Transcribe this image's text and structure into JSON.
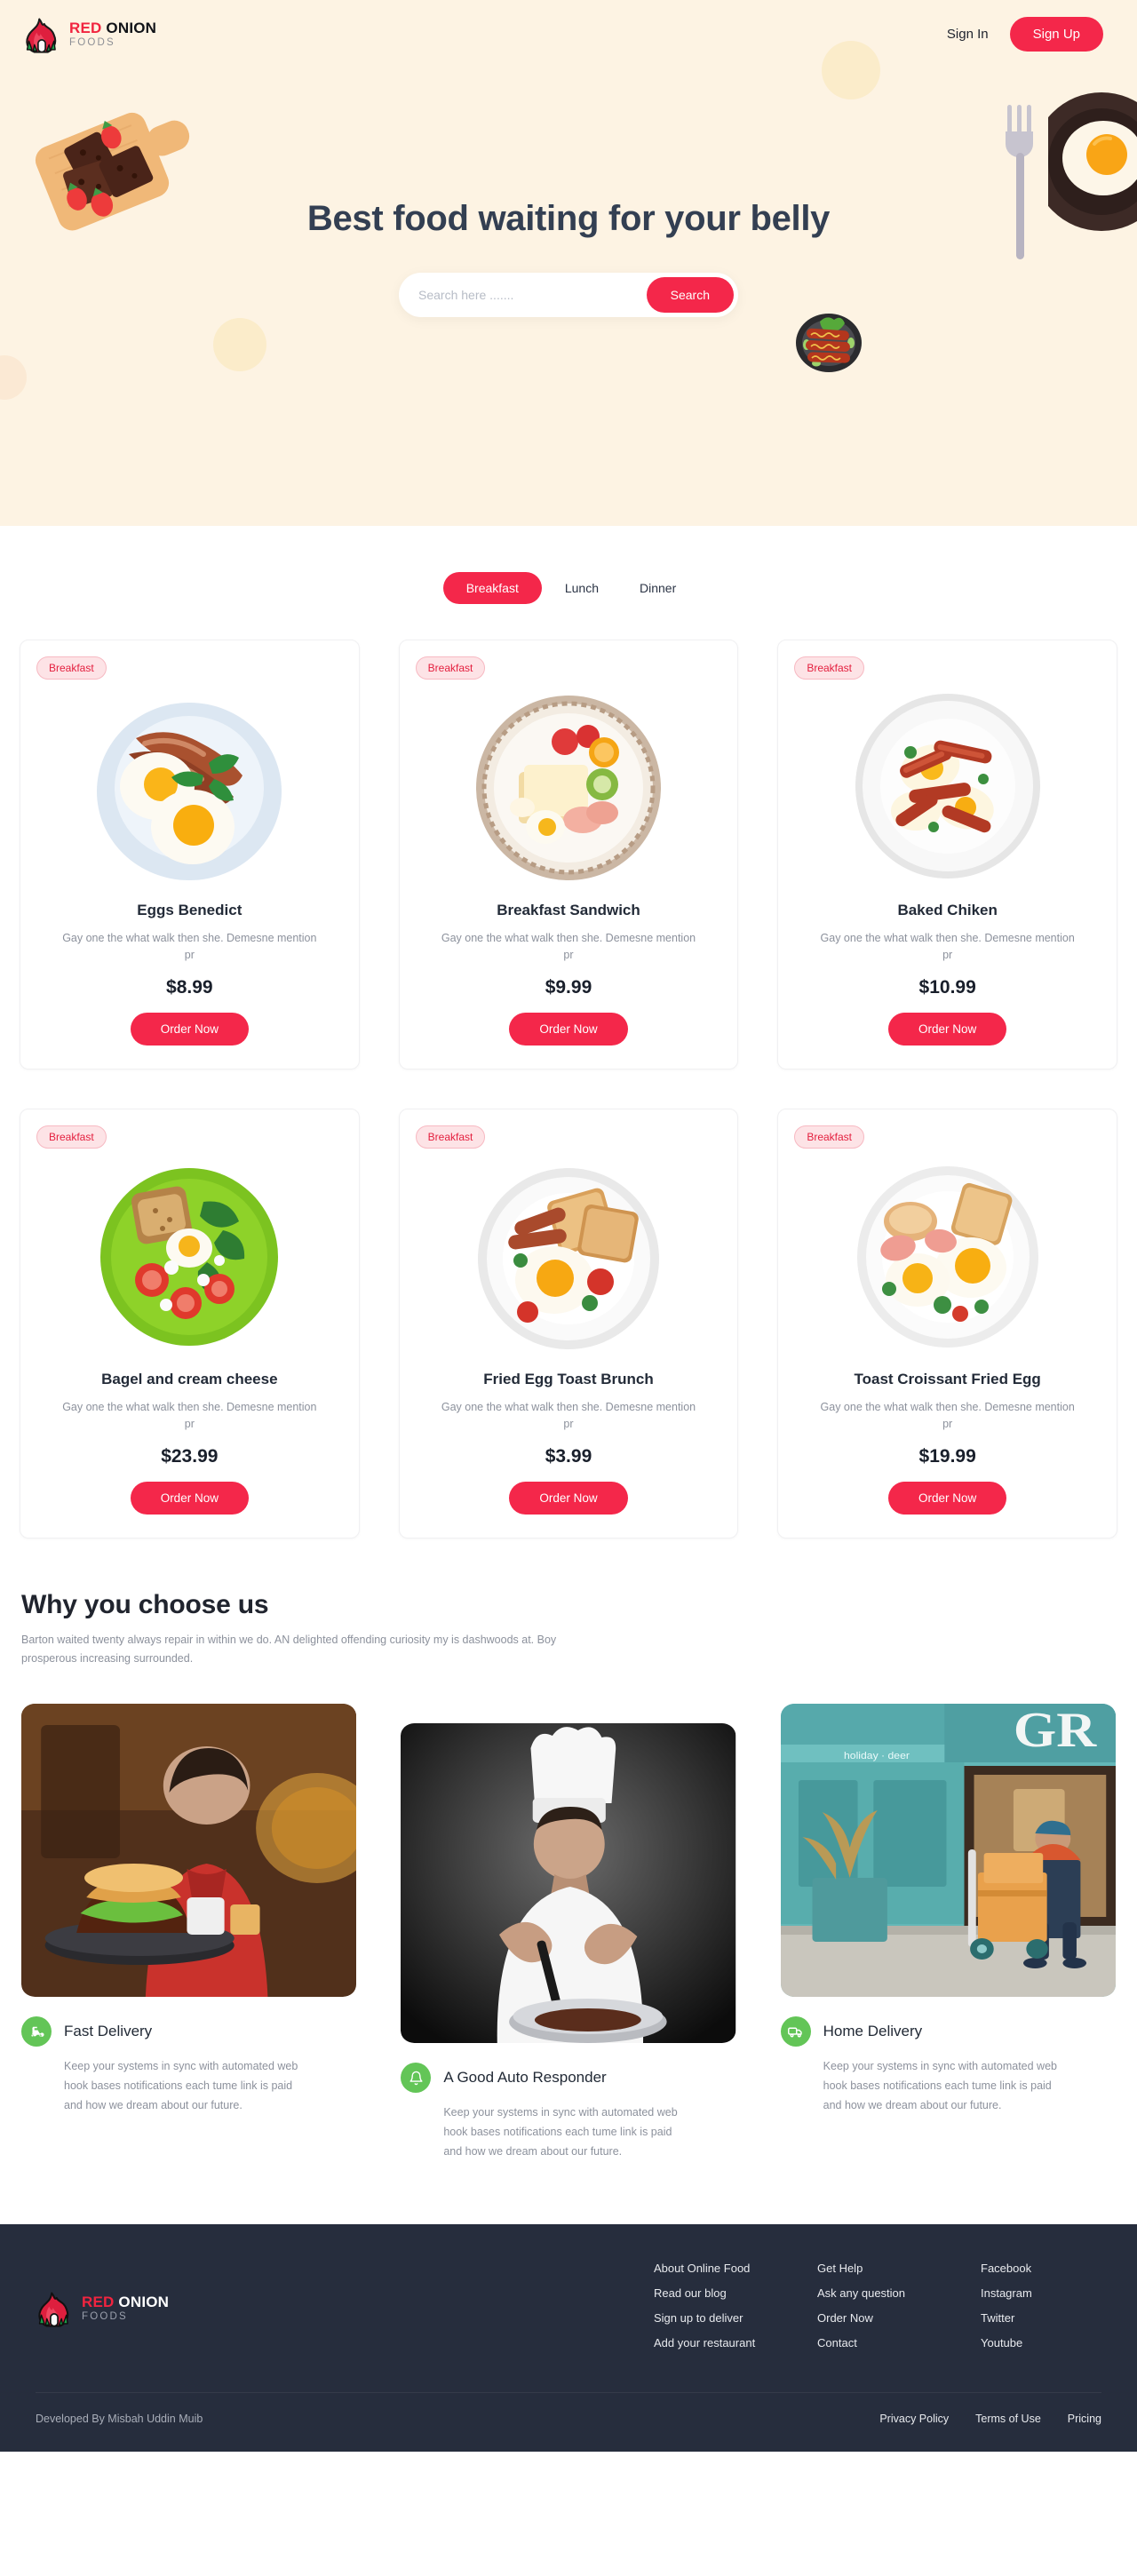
{
  "brand": {
    "line1_red": "RED",
    "line1_dark": " ONION",
    "line2": "FOODS"
  },
  "header": {
    "sign_in": "Sign In",
    "sign_up": "Sign Up"
  },
  "hero": {
    "title": "Best food waiting for your belly",
    "search_placeholder": "Search here .......",
    "search_value": "",
    "search_button": "Search",
    "accent_color": "#f4274a",
    "background_color": "#fdf3e3",
    "decorations": [
      "brownies-cutting-board-illustration",
      "fork-illustration",
      "fried-egg-pan-illustration",
      "sausage-pan-illustration"
    ]
  },
  "menu": {
    "tabs": [
      {
        "label": "Breakfast",
        "active": true
      },
      {
        "label": "Lunch",
        "active": false
      },
      {
        "label": "Dinner",
        "active": false
      }
    ],
    "order_label": "Order Now",
    "items": [
      {
        "badge": "Breakfast",
        "title": "Eggs Benedict",
        "desc": "Gay one the what walk then she. Demesne mention pr",
        "price": "$8.99",
        "image": "eggs-and-bacon-plate-photo"
      },
      {
        "badge": "Breakfast",
        "title": "Breakfast Sandwich",
        "desc": "Gay one the what walk then she. Demesne mention pr",
        "price": "$9.99",
        "image": "breakfast-sandwich-fruit-plate-photo"
      },
      {
        "badge": "Breakfast",
        "title": "Baked Chiken",
        "desc": "Gay one the what walk then she. Demesne mention pr",
        "price": "$10.99",
        "image": "baked-chicken-bowl-photo"
      },
      {
        "badge": "Breakfast",
        "title": "Bagel and cream cheese",
        "desc": "Gay one the what walk then she. Demesne mention pr",
        "price": "$23.99",
        "image": "green-plate-salad-egg-photo"
      },
      {
        "badge": "Breakfast",
        "title": "Fried Egg Toast Brunch",
        "desc": "Gay one the what walk then she. Demesne mention pr",
        "price": "$3.99",
        "image": "fried-egg-toast-bacon-photo"
      },
      {
        "badge": "Breakfast",
        "title": "Toast Croissant Fried Egg",
        "desc": "Gay one the what walk then she. Demesne mention pr",
        "price": "$19.99",
        "image": "toast-croissant-fried-egg-photo"
      }
    ]
  },
  "why": {
    "title": "Why you choose us",
    "subtitle": "Barton waited twenty always repair in within we do. AN delighted offending curiosity my is dashwoods at. Boy prosperous increasing surrounded.",
    "features": [
      {
        "name": "Fast Delivery",
        "icon": "scooter-icon",
        "icon_color": "#63c557",
        "text": "Keep your systems in sync with automated web hook bases notifications each tume link is paid and how we dream about our future.",
        "image": "delivery-man-holding-tray-photo"
      },
      {
        "name": "A Good Auto Responder",
        "icon": "bell-icon",
        "icon_color": "#63c557",
        "text": "Keep your systems in sync with automated web hook bases notifications each tume link is paid and how we dream about our future.",
        "image": "chef-cooking-photo"
      },
      {
        "name": "Home Delivery",
        "icon": "truck-icon",
        "icon_color": "#63c557",
        "text": "Keep your systems in sync with automated web hook bases notifications each tume link is paid and how we dream about our future.",
        "image": "courier-storefront-photo"
      }
    ]
  },
  "footer": {
    "columns": [
      [
        "About Online Food",
        "Read our blog",
        "Sign up to deliver",
        "Add your restaurant"
      ],
      [
        "Get Help",
        "Ask any question",
        "Order Now",
        "Contact"
      ],
      [
        "Facebook",
        "Instagram",
        "Twitter",
        "Youtube"
      ]
    ],
    "credit": "Developed By Misbah Uddin Muib",
    "legal": [
      "Privacy Policy",
      "Terms of Use",
      "Pricing"
    ],
    "background_color": "#262d3d"
  }
}
